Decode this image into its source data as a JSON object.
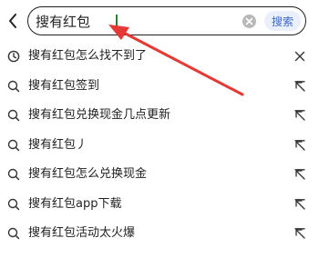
{
  "header": {
    "back_icon": "chevron-left-icon",
    "search": {
      "value": "搜有红包",
      "placeholder": "",
      "clear_icon": "clear-icon",
      "button_label": "搜索",
      "accent_color": "#3b66c4"
    }
  },
  "annotation": {
    "arrow_color": "#e53935"
  },
  "suggestions": [
    {
      "text": "搜有红包怎么找不到了",
      "icon": "history-clock-icon",
      "action_icon": "close-icon"
    },
    {
      "text": "搜有红包签到",
      "icon": "search-icon",
      "action_icon": "arrow-up-left-icon"
    },
    {
      "text": "搜有红包兑换现金几点更新",
      "icon": "search-icon",
      "action_icon": "arrow-up-left-icon"
    },
    {
      "text": "搜有红包丿",
      "icon": "search-icon",
      "action_icon": "arrow-up-left-icon"
    },
    {
      "text": "搜有红包怎么兑换现金",
      "icon": "search-icon",
      "action_icon": "arrow-up-left-icon"
    },
    {
      "text": "搜有红包app下载",
      "icon": "search-icon",
      "action_icon": "arrow-up-left-icon"
    },
    {
      "text": "搜有红包活动太火爆",
      "icon": "search-icon",
      "action_icon": "arrow-up-left-icon"
    }
  ]
}
